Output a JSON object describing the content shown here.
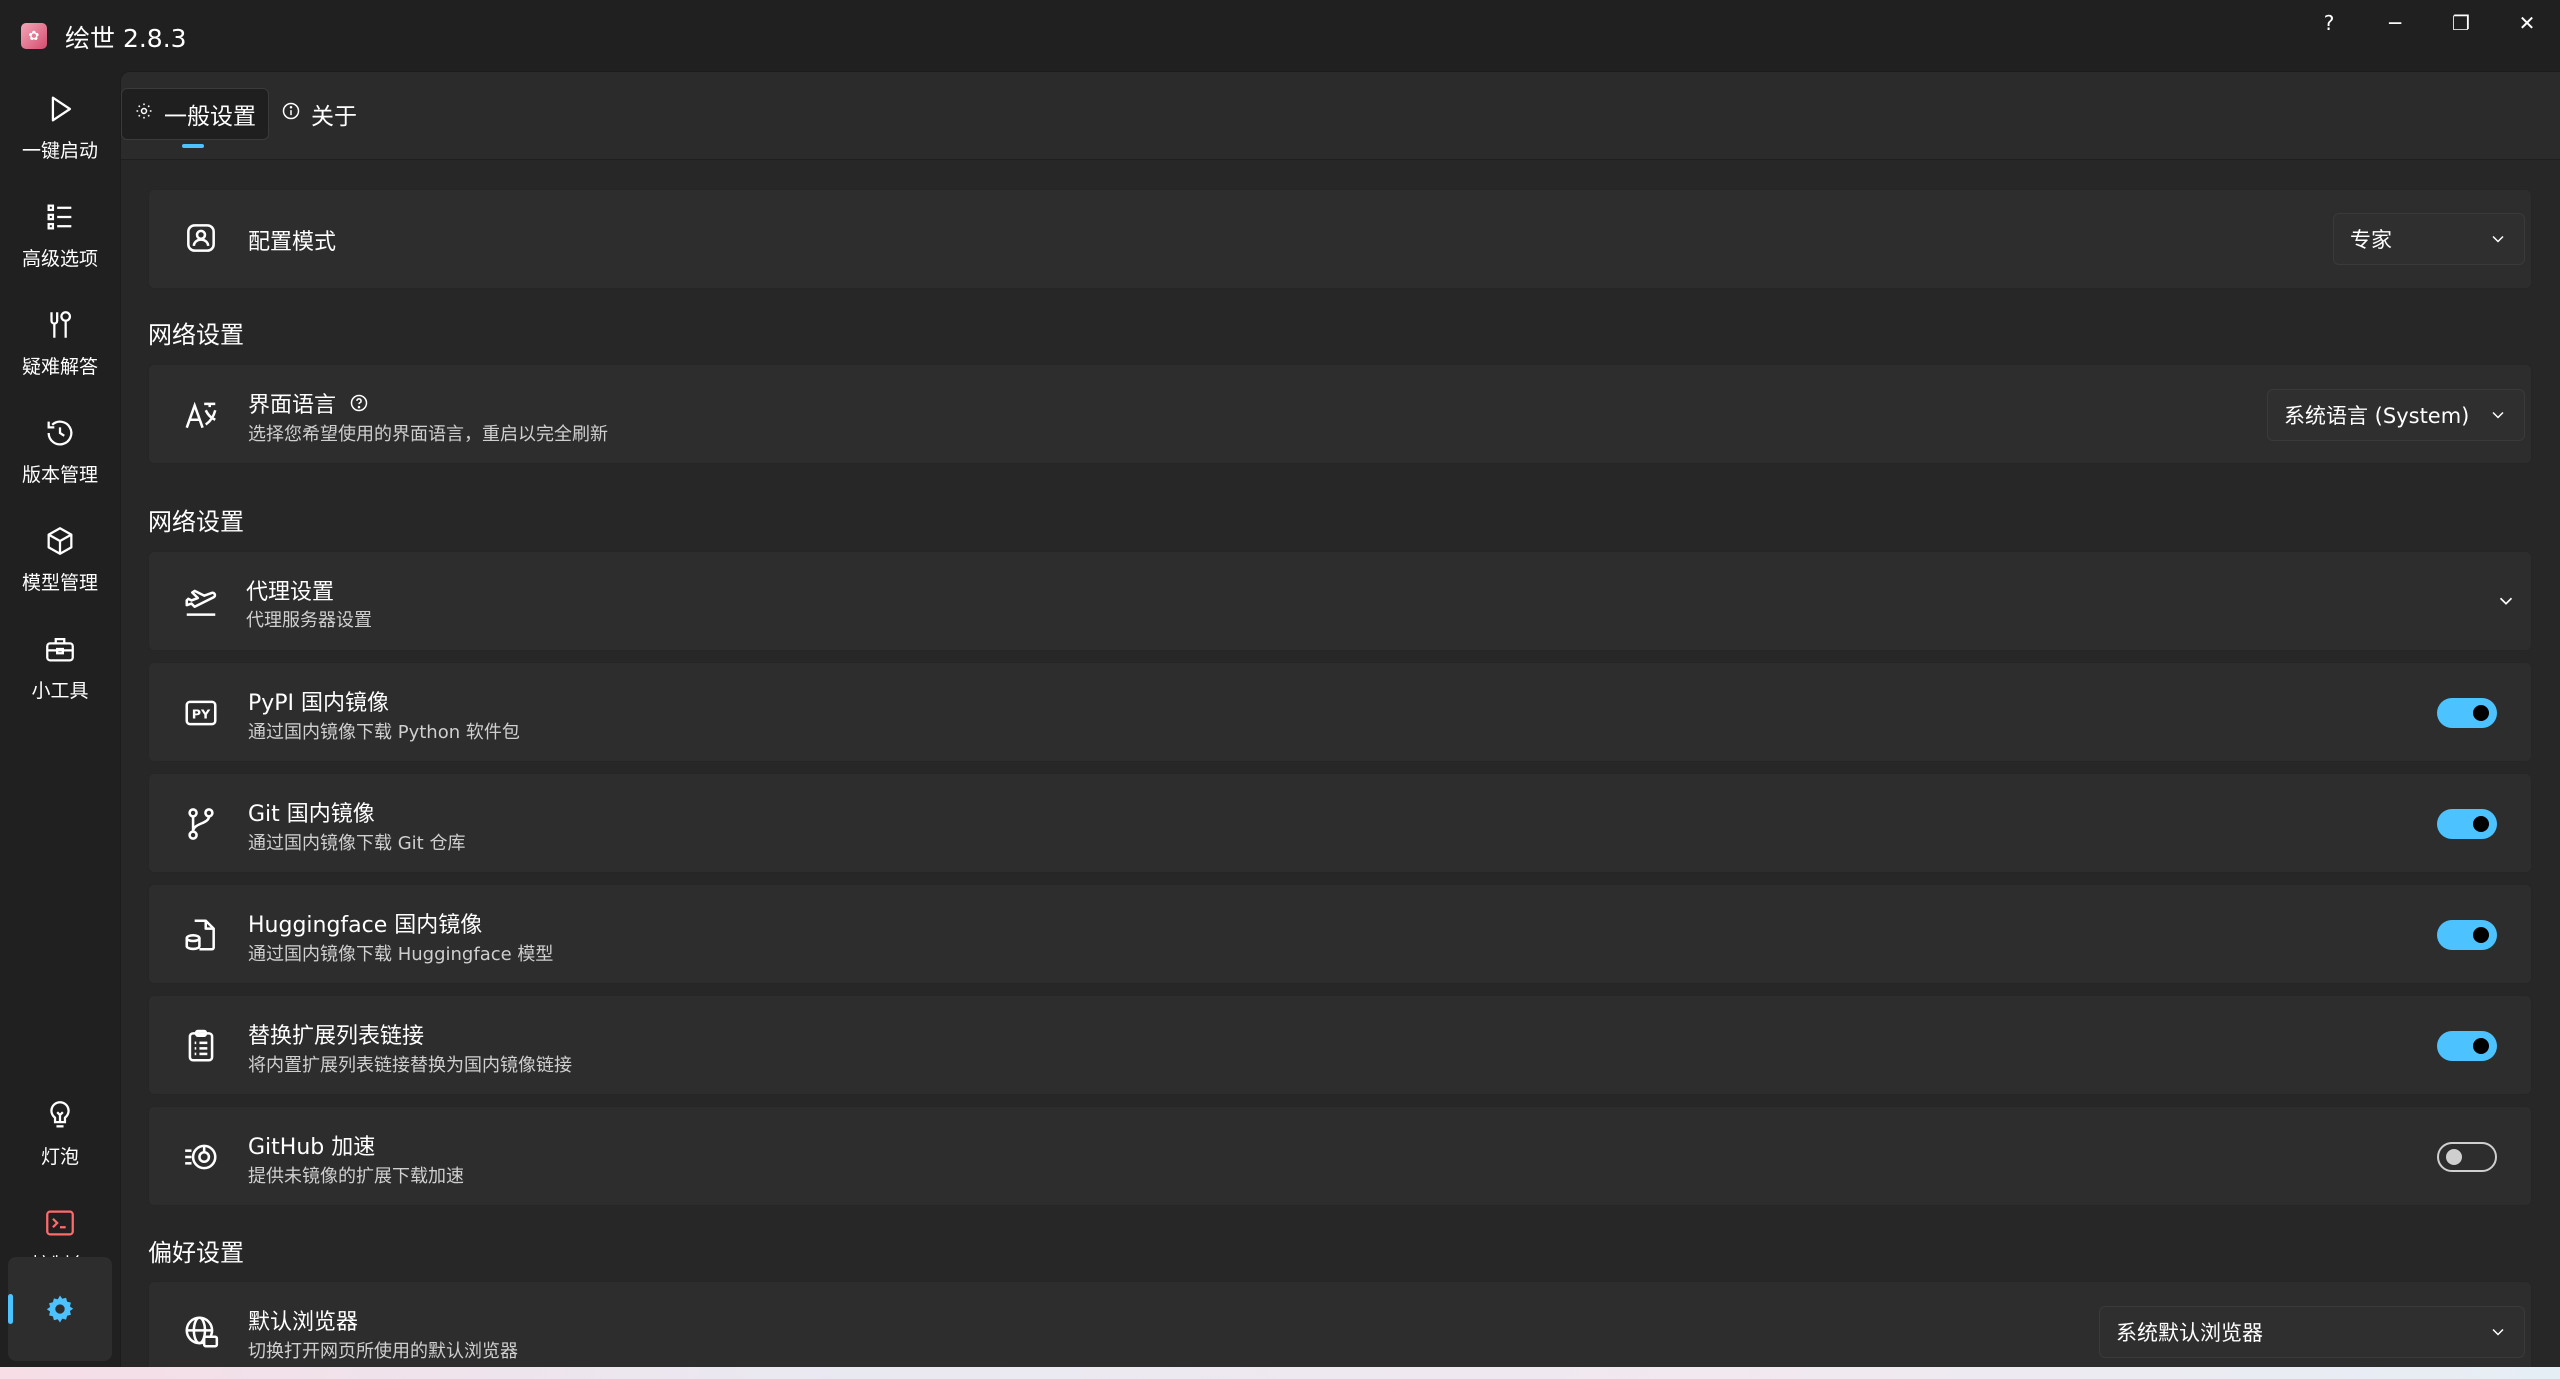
{
  "app": {
    "title": "绘世 2.8.3",
    "logo_icon": "app-logo-icon"
  },
  "window_controls": {
    "help": "?",
    "minimize": "─",
    "restore": "❐",
    "close": "✕"
  },
  "sidebar": {
    "items": [
      {
        "label": "一键启动",
        "icon": "play-icon"
      },
      {
        "label": "高级选项",
        "icon": "list-icon"
      },
      {
        "label": "疑难解答",
        "icon": "tools-icon"
      },
      {
        "label": "版本管理",
        "icon": "history-icon"
      },
      {
        "label": "模型管理",
        "icon": "box-icon"
      },
      {
        "label": "小工具",
        "icon": "toolbox-icon"
      },
      {
        "label": "灯泡",
        "icon": "lightbulb-icon"
      },
      {
        "label": "控制台",
        "icon": "console-icon"
      }
    ],
    "settings_icon": "gear-icon",
    "accent_color": "#4cc2ff"
  },
  "tabs": [
    {
      "label": "一般设置",
      "icon": "gear-icon",
      "active": true
    },
    {
      "label": "关于",
      "icon": "info-icon",
      "active": false
    }
  ],
  "config_mode": {
    "title": "配置模式",
    "value": "专家"
  },
  "sections": {
    "network1": "网络设置",
    "network2": "网络设置",
    "preferences": "偏好设置"
  },
  "language": {
    "title": "界面语言",
    "desc": "选择您希望使用的界面语言，重启以完全刷新",
    "value": "系统语言 (System)"
  },
  "proxy": {
    "title": "代理设置",
    "desc": "代理服务器设置"
  },
  "pypi": {
    "title": "PyPI 国内镜像",
    "desc": "通过国内镜像下载 Python 软件包",
    "enabled": true
  },
  "git": {
    "title": "Git 国内镜像",
    "desc": "通过国内镜像下载 Git 仓库",
    "enabled": true
  },
  "huggingface": {
    "title": "Huggingface 国内镜像",
    "desc": "通过国内镜像下载 Huggingface 模型",
    "enabled": true
  },
  "extlist": {
    "title": "替换扩展列表链接",
    "desc": "将内置扩展列表链接替换为国内镜像链接",
    "enabled": true
  },
  "github": {
    "title": "GitHub 加速",
    "desc": "提供未镜像的扩展下载加速",
    "enabled": false
  },
  "browser": {
    "title": "默认浏览器",
    "desc": "切换打开网页所使用的默认浏览器",
    "value": "系统默认浏览器"
  }
}
